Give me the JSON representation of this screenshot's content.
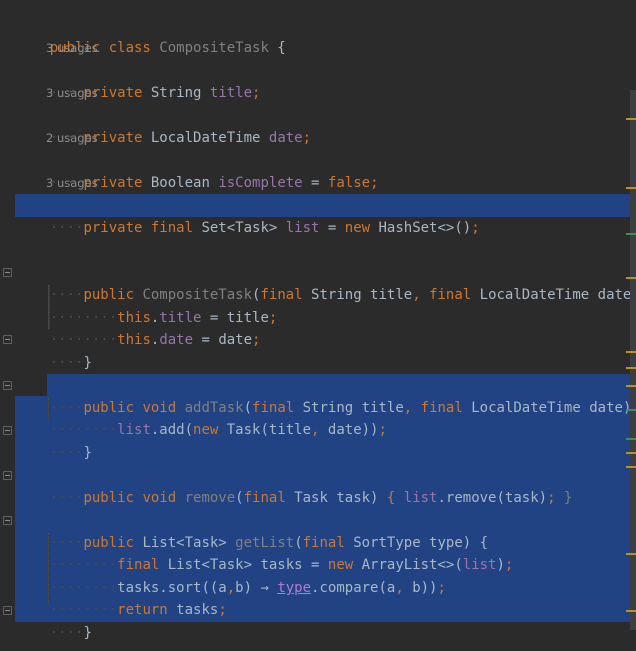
{
  "colors": {
    "background": "#2b2b2b",
    "selection": "#214283",
    "keyword": "#cc7832",
    "field": "#9876aa",
    "text": "#a9b7c6",
    "hint": "#8c8c8c",
    "marker_warning": "#be9117",
    "marker_change": "#3d8f58"
  },
  "code": {
    "class_kw": "public class ",
    "class_name": "CompositeTask",
    "class_open": " {",
    "hint1": "3 usages",
    "f1_kw": "private ",
    "f1_type": "String ",
    "f1_name": "title",
    "f1_end": ";",
    "hint2": "3 usages",
    "f2_kw": "private ",
    "f2_type": "LocalDateTime ",
    "f2_name": "date",
    "f2_end": ";",
    "hint3": "2 usages",
    "f3_kw": "private ",
    "f3_type": "Boolean ",
    "f3_name": "isComplete",
    "f3_eq": " = ",
    "f3_val": "false",
    "f3_end": ";",
    "hint4": "3 usages",
    "f4_kw": "private final ",
    "f4_type": "Set<Task> ",
    "f4_name": "list",
    "f4_eq": " = ",
    "f4_new": "new ",
    "f4_rest": "HashSet<>()",
    "f4_end": ";",
    "ctor_kw": "public ",
    "ctor_name": "CompositeTask",
    "ctor_open": "(",
    "ctor_p1kw": "final ",
    "ctor_p1": "String title",
    "ctor_comma": ", ",
    "ctor_p2kw": "final ",
    "ctor_p2": "LocalDateTime date",
    "ctor_close": ") {",
    "ctor_b1_this": "this",
    "ctor_b1_dot": ".",
    "ctor_b1_field": "title",
    "ctor_b1_rest": " = title",
    "ctor_b1_end": ";",
    "ctor_b2_this": "this",
    "ctor_b2_dot": ".",
    "ctor_b2_field": "date",
    "ctor_b2_rest": " = date",
    "ctor_b2_end": ";",
    "brace_close": "}",
    "add_kw": "public void ",
    "add_name": "addTask",
    "add_open": "(",
    "add_p1kw": "final ",
    "add_p1": "String title",
    "add_comma": ", ",
    "add_p2kw": "final ",
    "add_p2": "LocalDateTime date",
    "add_close": ") {",
    "add_b_list": "list",
    "add_b_add": ".add(",
    "add_b_new": "new ",
    "add_b_task": "Task(title",
    "add_b_comma": ", ",
    "add_b_rest": "date))",
    "add_b_end": ";",
    "rem_kw": "public void ",
    "rem_name": "remove",
    "rem_open": "(",
    "rem_pkw": "final ",
    "rem_p": "Task task",
    "rem_close": ") ",
    "rem_lb": "{ ",
    "rem_list": "list",
    "rem_call": ".remove(task)",
    "rem_semi": "; ",
    "rem_rb": "}",
    "get_kw": "public ",
    "get_type": "List<Task> ",
    "get_name": "getList",
    "get_open": "(",
    "get_pkw": "final ",
    "get_p": "SortType type",
    "get_close": ") {",
    "get_b1_kw": "final ",
    "get_b1_type": "List<Task> ",
    "get_b1_var": "tasks = ",
    "get_b1_new": "new ",
    "get_b1_cls": "ArrayList<>(",
    "get_b1_list": "list",
    "get_b1_close": ")",
    "get_b1_end": ";",
    "get_b2_start": "tasks.sort((a",
    "get_b2_comma": ",",
    "get_b2_mid": "b) → ",
    "get_b2_type": "type",
    "get_b2_call": ".compare(a",
    "get_b2_comma2": ", ",
    "get_b2_end": "b))",
    "get_b2_semi": ";",
    "get_b3_kw": "return ",
    "get_b3_val": "tasks",
    "get_b3_end": ";",
    "dots": "····"
  }
}
